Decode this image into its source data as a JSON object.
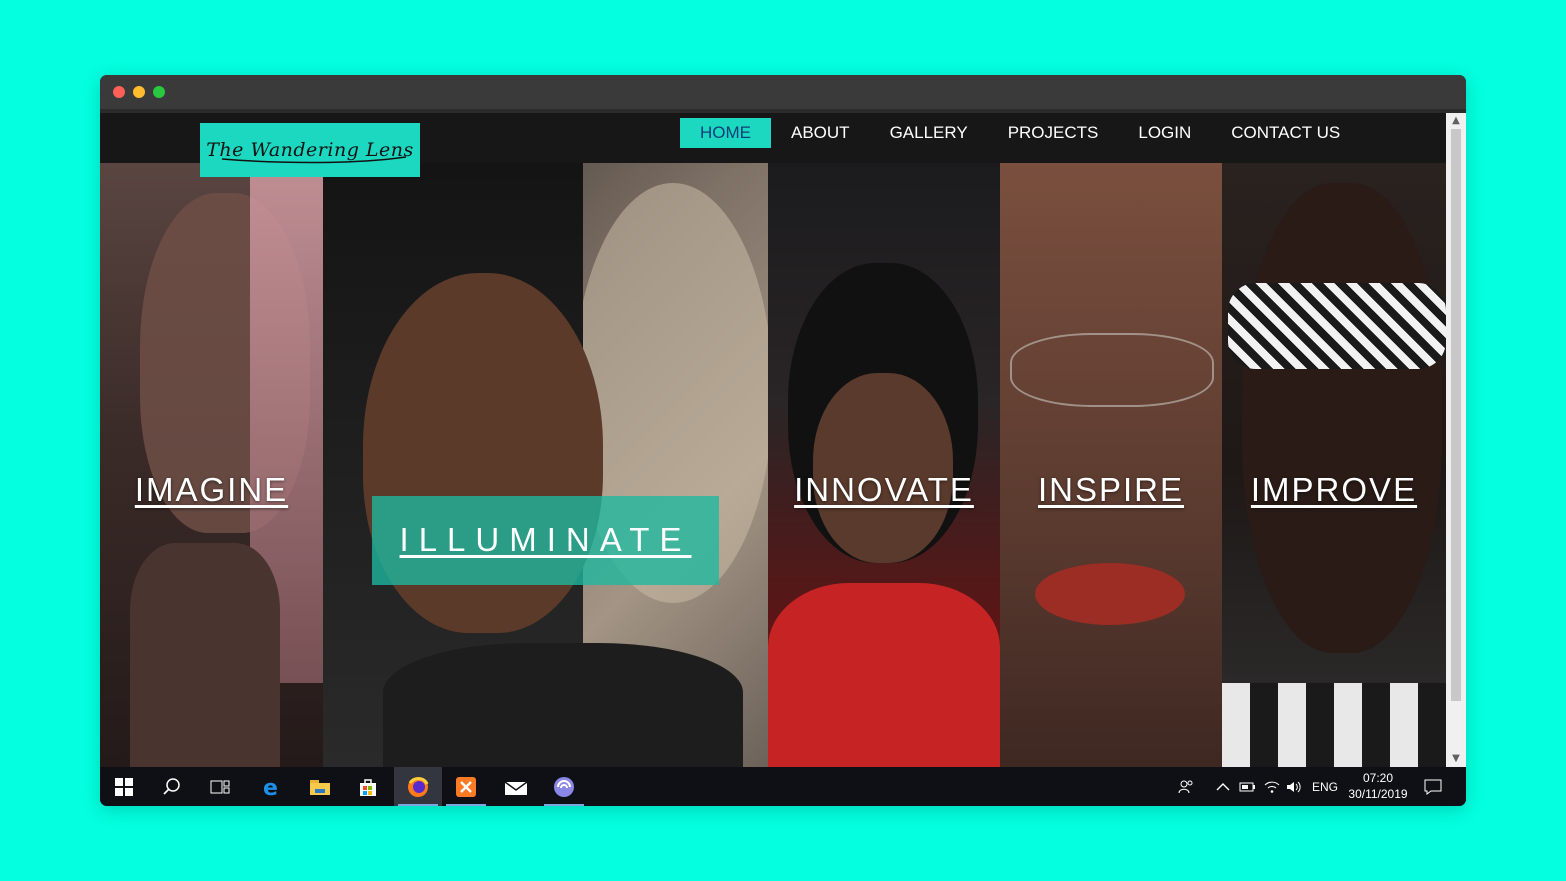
{
  "colors": {
    "background": "#03ffe0",
    "accent": "#1dd8c0",
    "nav_bg": "#171717",
    "active_nav_text": "#0b3f7a"
  },
  "site": {
    "logo_text": "The Wandering Lens"
  },
  "nav": {
    "items": [
      {
        "label": "HOME",
        "active": true
      },
      {
        "label": "ABOUT",
        "active": false
      },
      {
        "label": "GALLERY",
        "active": false
      },
      {
        "label": "PROJECTS",
        "active": false
      },
      {
        "label": "LOGIN",
        "active": false
      },
      {
        "label": "CONTACT US",
        "active": false
      }
    ]
  },
  "panels": [
    {
      "label": "IMAGINE",
      "highlighted": false
    },
    {
      "label": "ILLUMINATE",
      "highlighted": true
    },
    {
      "label": "INNOVATE",
      "highlighted": false
    },
    {
      "label": "INSPIRE",
      "highlighted": false
    },
    {
      "label": "IMPROVE",
      "highlighted": false
    }
  ],
  "taskbar": {
    "icons": [
      "windows-start-icon",
      "search-icon",
      "task-view-icon",
      "edge-icon",
      "file-explorer-icon",
      "store-icon",
      "firefox-icon",
      "xampp-icon",
      "mail-icon",
      "app-icon"
    ],
    "active_icon": "firefox-icon",
    "language": "ENG",
    "time": "07:20",
    "date": "30/11/2019"
  }
}
